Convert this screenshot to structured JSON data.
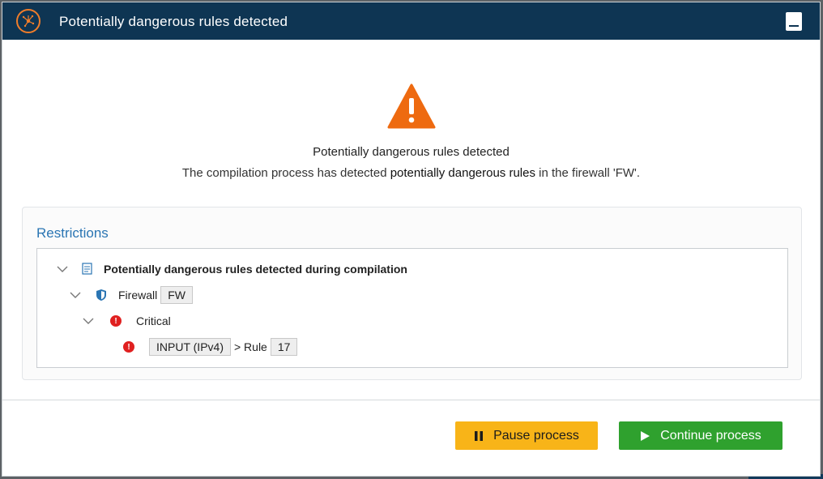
{
  "dialog": {
    "title": "Potentially dangerous rules detected",
    "heading": "Potentially dangerous rules detected",
    "description_prefix": "The compilation process has detected ",
    "description_bold": "potentially dangerous rules",
    "description_suffix": " in the firewall 'FW'.",
    "warning_color": "#ee6a10"
  },
  "restrictions": {
    "title": "Restrictions",
    "tree": {
      "root_label": "Potentially dangerous rules detected during compilation",
      "firewall_label": "Firewall",
      "firewall_tag": "FW",
      "severity_label": "Critical",
      "chain_tag": "INPUT (IPv4)",
      "rule_text": "> Rule",
      "rule_tag": "17"
    }
  },
  "buttons": {
    "pause": "Pause process",
    "continue": "Continue process"
  },
  "colors": {
    "titlebar": "#0e3553",
    "pause": "#f8b418",
    "continue": "#2fa12e",
    "accent_blue": "#2a75b3",
    "error_red": "#e02020"
  }
}
